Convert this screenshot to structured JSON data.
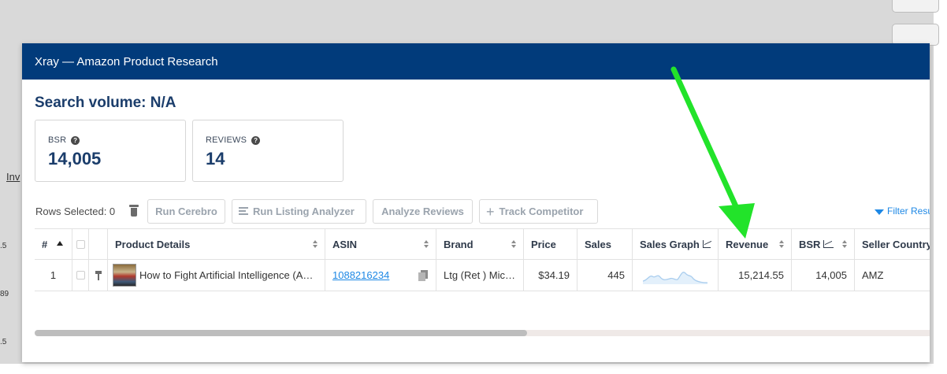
{
  "background": {
    "left_link": "Inv",
    "edge_numbers": [
      ".5",
      "89",
      ".5"
    ]
  },
  "modal": {
    "title": "Xray — Amazon Product Research"
  },
  "search_volume": "Search volume: N/A",
  "stats": {
    "bsr": {
      "label": "BSR",
      "value": "14,005"
    },
    "reviews": {
      "label": "REVIEWS",
      "value": "14"
    }
  },
  "toolbar": {
    "rows_selected": "Rows Selected: 0",
    "run_cerebro": "Run Cerebro",
    "run_listing_analyzer": "Run Listing Analyzer",
    "analyze_reviews": "Analyze Reviews",
    "track_competitor": "Track Competitor",
    "filter_results": "Filter Resu"
  },
  "table": {
    "headers": {
      "num": "#",
      "product": "Product Details",
      "asin": "ASIN",
      "brand": "Brand",
      "price": "Price",
      "sales": "Sales",
      "sales_graph": "Sales Graph",
      "revenue": "Revenue",
      "bsr": "BSR",
      "seller_country": "Seller Country"
    },
    "rows": [
      {
        "num": "1",
        "product": "How to Fight Artificial Intelligence (A…",
        "asin": "1088216234",
        "brand": "Ltg (Ret ) Mic…",
        "price": "$34.19",
        "sales": "445",
        "revenue": "15,214.55",
        "bsr": "14,005",
        "seller_country": "AMZ"
      }
    ]
  },
  "colors": {
    "header_bg": "#013b7b",
    "accent_blue": "#1e88e5",
    "arrow_green": "#22e32a",
    "sparkline": "#a9cdee"
  },
  "icons": [
    "help-icon",
    "trash-icon",
    "list-icon",
    "plus-icon",
    "filter-icon",
    "sort-icon",
    "graph-icon",
    "pin-icon",
    "copy-icon"
  ]
}
